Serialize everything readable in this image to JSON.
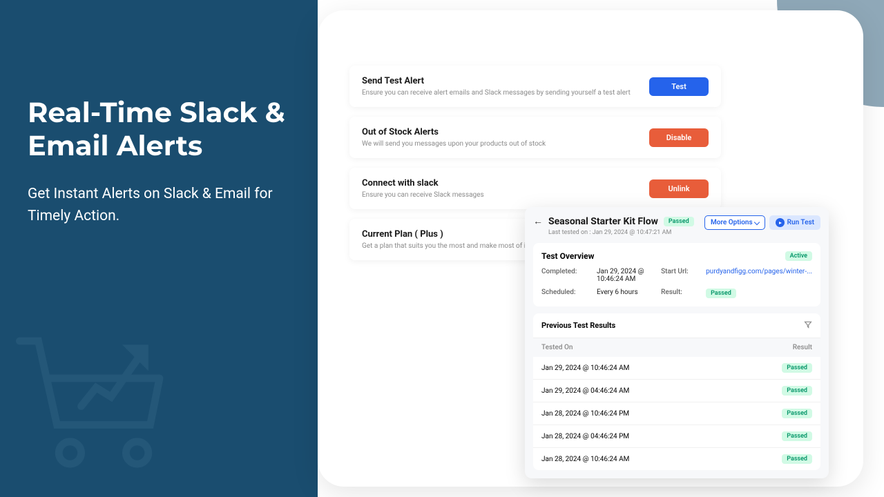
{
  "hero": {
    "title": "Real-Time Slack & Email Alerts",
    "subtitle": "Get Instant Alerts on Slack & Email for Timely Action."
  },
  "cards": [
    {
      "title": "Send Test Alert",
      "desc": "Ensure you can receive alert emails and Slack messages by sending yourself a test alert",
      "button": "Test",
      "style": "blue"
    },
    {
      "title": "Out of Stock Alerts",
      "desc": "We will send you messages upon your products out of stock",
      "button": "Disable",
      "style": "orange"
    },
    {
      "title": "Connect with slack",
      "desc": "Ensure you can receive Slack messages",
      "button": "Unlink",
      "style": "orange"
    },
    {
      "title": "Current Plan ( Plus )",
      "desc": "Get a plan that suits you the most and make most of it",
      "button": "",
      "style": ""
    }
  ],
  "flow": {
    "title": "Seasonal Starter Kit Flow",
    "status_badge": "Passed",
    "last_tested": "Last tested on : Jan 29, 2024 @ 10:47:21 AM",
    "more_options": "More Options",
    "run_test": "Run Test"
  },
  "overview": {
    "title": "Test Overview",
    "active_badge": "Active",
    "completed_label": "Completed:",
    "completed_value": "Jan 29, 2024 @ 10:46:24 AM",
    "scheduled_label": "Scheduled:",
    "scheduled_value": "Every 6 hours",
    "start_url_label": "Start Url:",
    "start_url_value": "purdyandfigg.com/pages/winter-...",
    "result_label": "Result:",
    "result_value": "Passed"
  },
  "results": {
    "title": "Previous Test Results",
    "col_tested": "Tested On",
    "col_result": "Result",
    "rows": [
      {
        "tested": "Jan 29, 2024 @ 10:46:24 AM",
        "result": "Passed"
      },
      {
        "tested": "Jan 29, 2024 @ 04:46:24 AM",
        "result": "Passed"
      },
      {
        "tested": "Jan 28, 2024 @ 10:46:24 PM",
        "result": "Passed"
      },
      {
        "tested": "Jan 28, 2024 @ 04:46:24 PM",
        "result": "Passed"
      },
      {
        "tested": "Jan 28, 2024 @ 10:46:24 AM",
        "result": "Passed"
      }
    ]
  }
}
